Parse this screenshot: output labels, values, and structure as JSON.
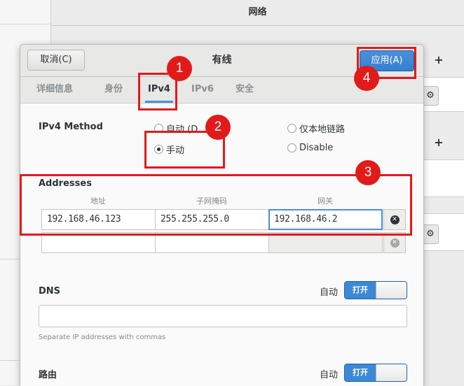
{
  "background": {
    "header_title": "网络"
  },
  "dialog": {
    "cancel_label": "取消(C)",
    "title": "有线",
    "apply_label": "应用(A)"
  },
  "tabs": [
    {
      "label": "详细信息",
      "active": false
    },
    {
      "label": "身份",
      "active": false
    },
    {
      "label": "IPv4",
      "active": true
    },
    {
      "label": "IPv6",
      "active": false
    },
    {
      "label": "安全",
      "active": false
    }
  ],
  "ipv4": {
    "method_label": "IPv4 Method",
    "options": [
      {
        "label": "自动 (D",
        "checked": false
      },
      {
        "label": "仅本地链路",
        "checked": false
      },
      {
        "label": "手动",
        "checked": true
      },
      {
        "label": "Disable",
        "checked": false
      }
    ]
  },
  "addresses": {
    "heading": "Addresses",
    "columns": [
      "地址",
      "子网掩码",
      "网关"
    ],
    "rows": [
      {
        "address": "192.168.46.123",
        "netmask": "255.255.255.0",
        "gateway": "192.168.46.2"
      },
      {
        "address": "",
        "netmask": "",
        "gateway": ""
      }
    ]
  },
  "dns": {
    "heading": "DNS",
    "auto_label": "自动",
    "switch_label": "打开",
    "hint": "Separate IP addresses with commas",
    "value": ""
  },
  "routes": {
    "heading": "路由",
    "auto_label": "自动",
    "switch_label": "打开"
  },
  "annotations": [
    "1",
    "2",
    "3",
    "4"
  ],
  "colors": {
    "accent": "#4a90d9",
    "annotation_red": "#e21a1a"
  }
}
